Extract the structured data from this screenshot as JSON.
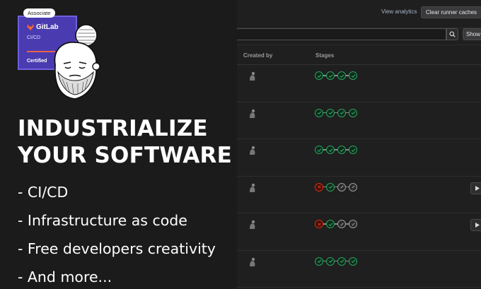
{
  "badge": {
    "associate_label": "Associate",
    "brand": "GitLab",
    "track": "CI/CD",
    "certified_label": "Certified"
  },
  "headline": {
    "line1": "INDUSTRIALIZE",
    "line2": "YOUR SOFTWARE"
  },
  "bullets": [
    "- CI/CD",
    "- Infrastructure as code",
    "- Free developers creativity",
    "- And more..."
  ],
  "gitlab_ui": {
    "view_analytics_label": "View analytics",
    "clear_caches_label": "Clear runner caches",
    "search_value": "",
    "show_label": "Show",
    "columns": {
      "created_by": "Created by",
      "stages": "Stages"
    },
    "pipelines": [
      {
        "stages": [
          "success",
          "success",
          "success",
          "success"
        ],
        "has_play": false
      },
      {
        "stages": [
          "success",
          "success",
          "success",
          "success"
        ],
        "has_play": false
      },
      {
        "stages": [
          "success",
          "success",
          "success",
          "success"
        ],
        "has_play": false
      },
      {
        "stages": [
          "failed",
          "success",
          "skipped",
          "skipped"
        ],
        "has_play": true
      },
      {
        "stages": [
          "failed",
          "success",
          "skipped",
          "skipped"
        ],
        "has_play": true
      },
      {
        "stages": [
          "success",
          "success",
          "success",
          "success"
        ],
        "has_play": false
      }
    ],
    "colors": {
      "success": "#2da160",
      "failed": "#dd2b0e",
      "skipped": "#9a9a9a",
      "badge": "#4b3bb0"
    }
  }
}
